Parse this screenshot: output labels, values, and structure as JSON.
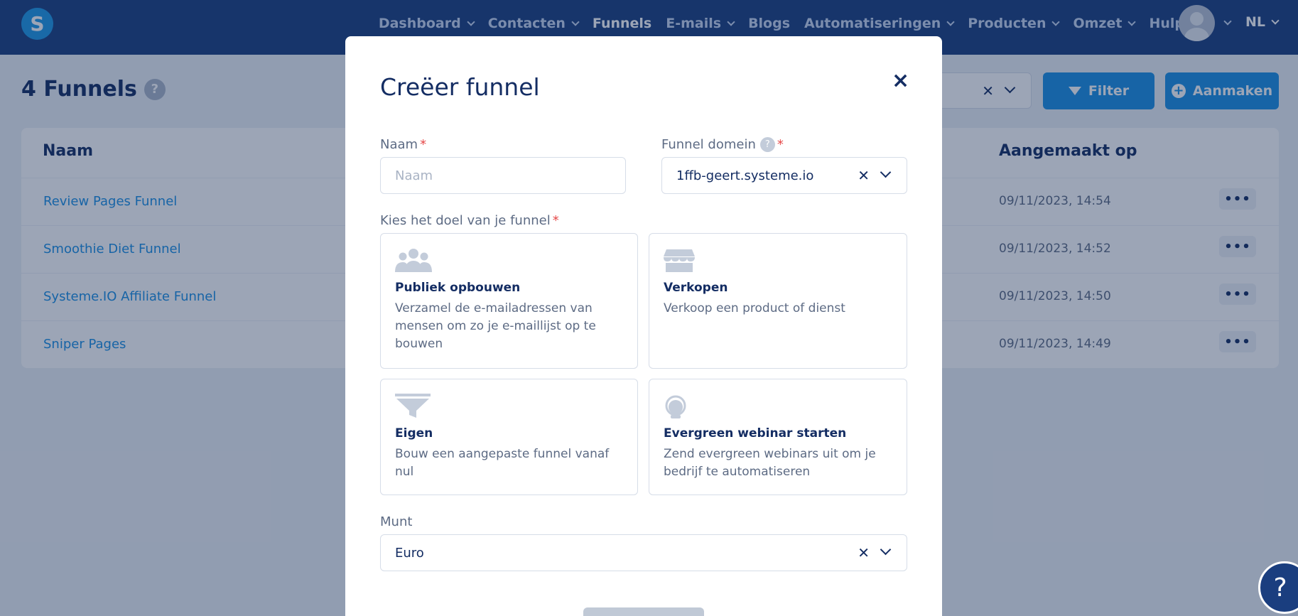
{
  "nav": {
    "logo": "S",
    "items": [
      {
        "label": "Dashboard",
        "dropdown": true
      },
      {
        "label": "Contacten",
        "dropdown": true
      },
      {
        "label": "Funnels",
        "dropdown": false
      },
      {
        "label": "E-mails",
        "dropdown": true
      },
      {
        "label": "Blogs",
        "dropdown": false
      },
      {
        "label": "Automatiseringen",
        "dropdown": true
      },
      {
        "label": "Producten",
        "dropdown": true
      },
      {
        "label": "Omzet",
        "dropdown": true
      },
      {
        "label": "Hulp",
        "dropdown": false
      }
    ],
    "active": "Funnels",
    "lang": "NL"
  },
  "page": {
    "title": "4 Funnels",
    "help": "?",
    "filter_label": "Filter",
    "create_label": "Aanmaken"
  },
  "table": {
    "col_name": "Naam",
    "col_created": "Aangemaakt op",
    "rows": [
      {
        "name": "Review Pages Funnel",
        "created": "09/11/2023, 14:54",
        "more": "•••"
      },
      {
        "name": "Smoothie Diet Funnel",
        "created": "09/11/2023, 14:52",
        "more": "•••"
      },
      {
        "name": "Systeme.IO Affiliate Funnel",
        "created": "09/11/2023, 14:50",
        "more": "•••"
      },
      {
        "name": "Sniper Pages",
        "created": "09/11/2023, 14:49",
        "more": "•••"
      }
    ]
  },
  "modal": {
    "title": "Creëer funnel",
    "close": "×",
    "name_label": "Naam",
    "name_placeholder": "Naam",
    "required_mark": "*",
    "domain_label": "Funnel domein",
    "domain_help": "?",
    "domain_value": "1ffb-geert.systeme.io",
    "goal_label": "Kies het doel van je funnel",
    "goals": [
      {
        "title": "Publiek opbouwen",
        "desc": "Verzamel de e-mailadressen van mensen om zo je e-maillijst op te bouwen",
        "icon": "people-icon"
      },
      {
        "title": "Verkopen",
        "desc": "Verkoop een product of dienst",
        "icon": "store-icon"
      },
      {
        "title": "Eigen",
        "desc": "Bouw een aangepaste funnel vanaf nul",
        "icon": "funnel-icon"
      },
      {
        "title": "Evergreen webinar starten",
        "desc": "Zend evergreen webinars uit om je bedrijf te automatiseren",
        "icon": "headset-icon"
      }
    ],
    "currency_label": "Munt",
    "currency_value": "Euro",
    "clear_symbol": "✕"
  },
  "help_fab": "?"
}
